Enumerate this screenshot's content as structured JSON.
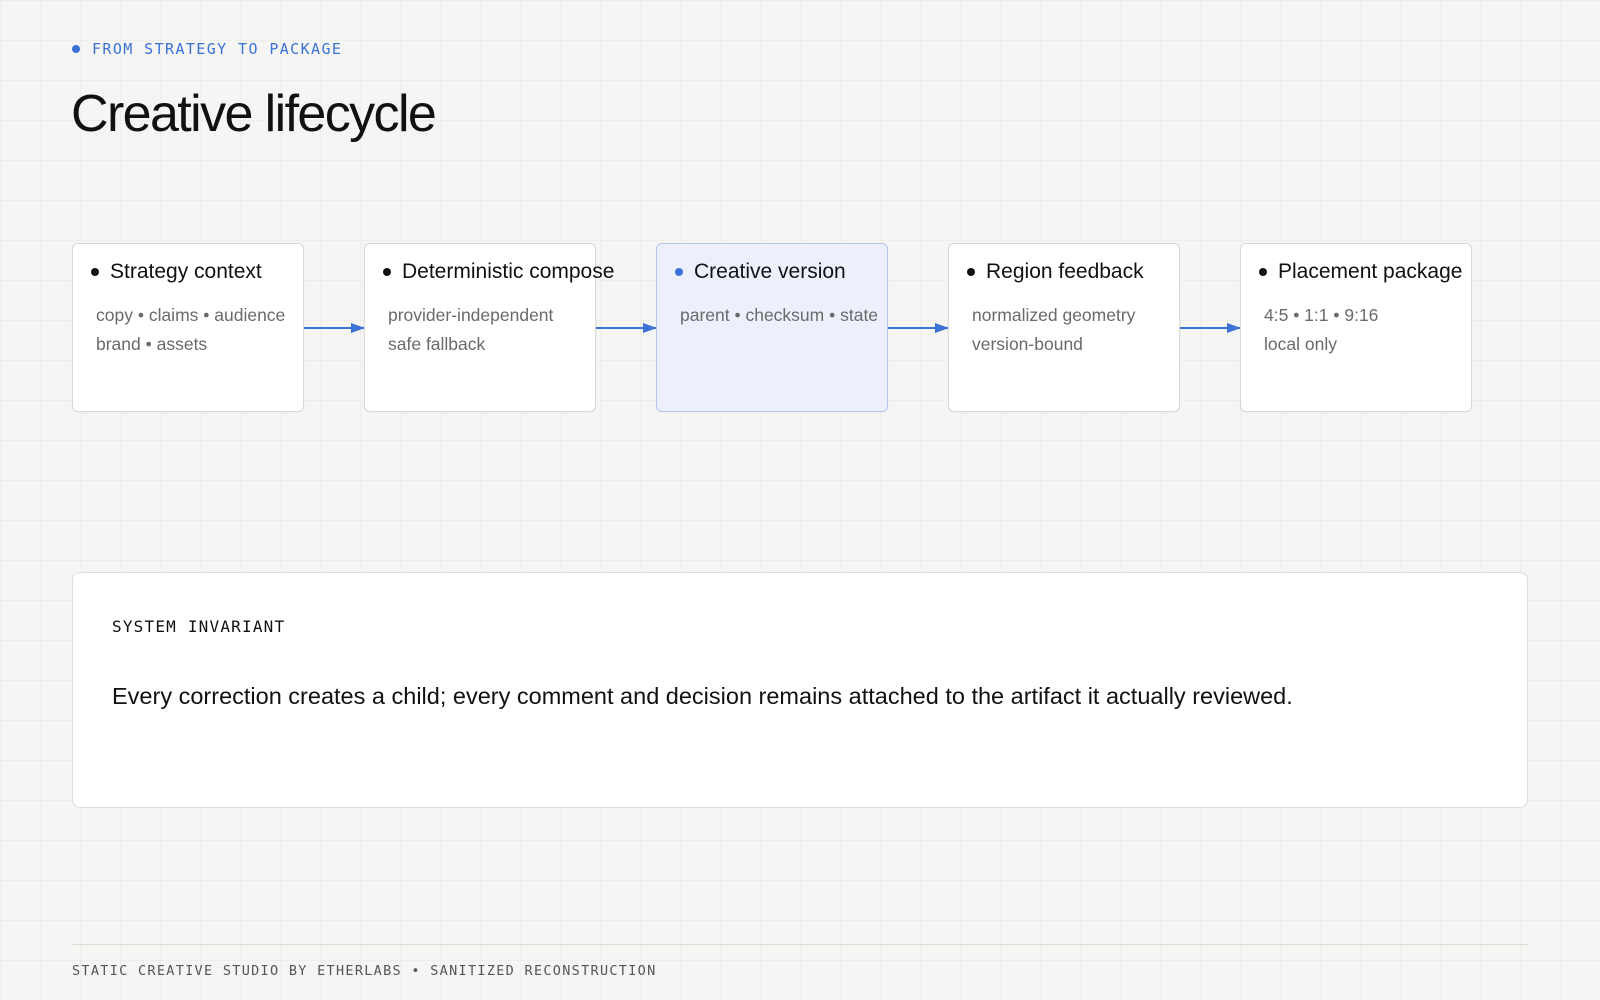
{
  "header": {
    "eyebrow": "FROM STRATEGY TO PACKAGE",
    "title": "Creative lifecycle"
  },
  "flow": {
    "nodes": [
      {
        "title": "Strategy context",
        "lines": [
          "copy • claims • audience",
          "brand • assets"
        ],
        "active": false
      },
      {
        "title": "Deterministic compose",
        "lines": [
          "provider-independent",
          "safe fallback"
        ],
        "active": false
      },
      {
        "title": "Creative version",
        "lines": [
          "parent • checksum • state"
        ],
        "active": true
      },
      {
        "title": "Region feedback",
        "lines": [
          "normalized geometry",
          "version-bound"
        ],
        "active": false
      },
      {
        "title": "Placement package",
        "lines": [
          "4:5 • 1:1 • 9:16",
          "local only"
        ],
        "active": false
      }
    ],
    "edges": [
      [
        0,
        1
      ],
      [
        1,
        2
      ],
      [
        2,
        3
      ],
      [
        3,
        4
      ]
    ]
  },
  "invariant": {
    "label": "SYSTEM INVARIANT",
    "text": "Every correction creates a child; every comment and decision remains attached to the artifact it actually reviewed."
  },
  "footer": {
    "text": "STATIC CREATIVE STUDIO BY ETHERLABS • SANITIZED RECONSTRUCTION"
  },
  "colors": {
    "accent": "#3a72d6",
    "active_node_fill": "#edf0fb",
    "background": "#f5f5f3"
  }
}
